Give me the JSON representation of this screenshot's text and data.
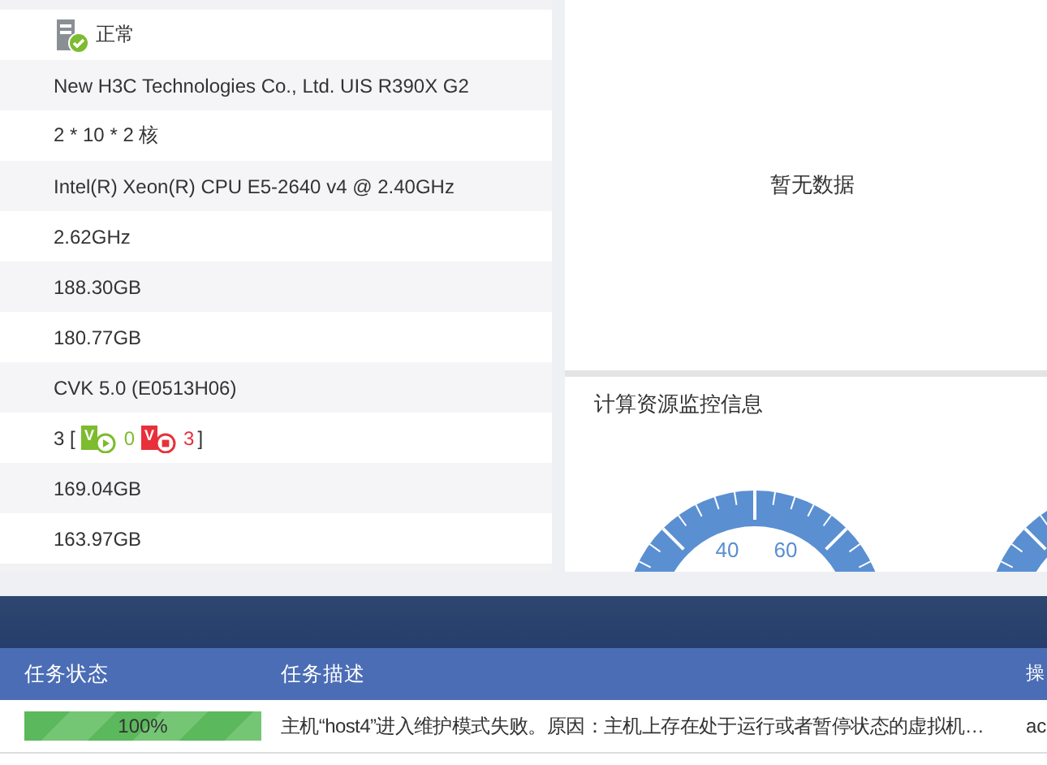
{
  "host_info": {
    "rows": [
      {
        "kind": "status",
        "text": "正常"
      },
      {
        "kind": "text",
        "text": "New H3C Technologies Co., Ltd. UIS R390X G2"
      },
      {
        "kind": "text",
        "text": "2 * 10 * 2 核"
      },
      {
        "kind": "text",
        "text": "Intel(R) Xeon(R) CPU E5-2640 v4 @ 2.40GHz"
      },
      {
        "kind": "text",
        "text": "2.62GHz"
      },
      {
        "kind": "text",
        "text": "188.30GB"
      },
      {
        "kind": "text",
        "text": "180.77GB"
      },
      {
        "kind": "text",
        "text": "CVK 5.0 (E0513H06)"
      },
      {
        "kind": "vms",
        "prefix": "3 [",
        "icon_letter": "V",
        "running": "0",
        "stopped_icon_letter": "V",
        "stopped": "3",
        "suffix": "]"
      },
      {
        "kind": "text",
        "text": "169.04GB"
      },
      {
        "kind": "text",
        "text": "163.97GB"
      }
    ]
  },
  "empty_panel": {
    "message": "暂无数据"
  },
  "monitor": {
    "title": "计算资源监控信息",
    "gauge_labels": [
      "40",
      "60"
    ]
  },
  "tasks": {
    "columns": [
      "任务状态",
      "任务描述",
      "操"
    ],
    "rows": [
      {
        "level": 1,
        "progress": "100%",
        "description": "主机“host4”进入维护模式失败。原因：主机上存在处于运行或者暂停状态的虚拟机…",
        "column_3": "ac"
      }
    ]
  }
}
